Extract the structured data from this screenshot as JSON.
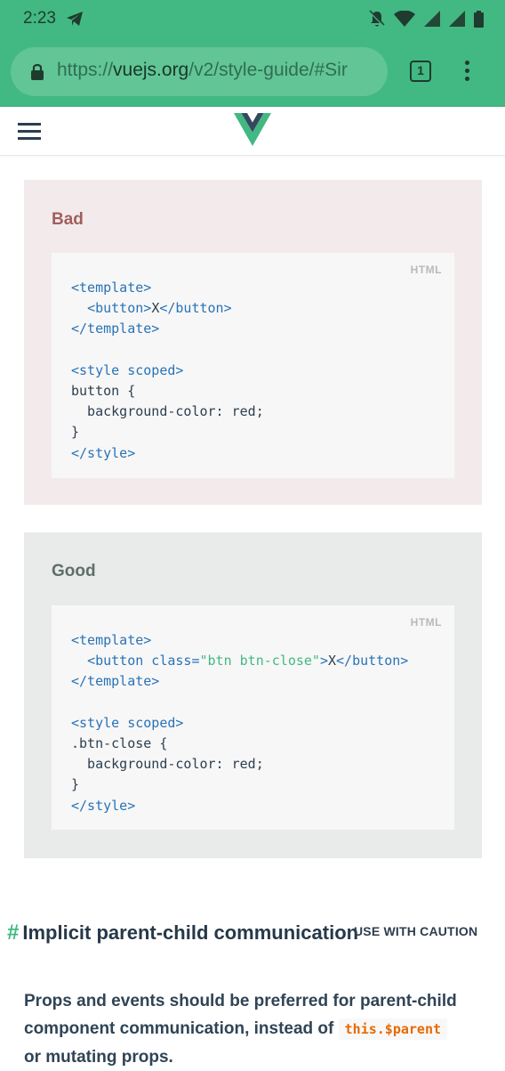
{
  "status_bar": {
    "time": "2:23",
    "icons": [
      "telegram-icon",
      "notifications-off-icon",
      "wifi-icon",
      "signal-icon",
      "signal-icon",
      "battery-icon"
    ]
  },
  "browser": {
    "url_prefix": "https://",
    "url_domain": "vuejs.org",
    "url_path": "/v2/style-guide/#Sir",
    "tab_count": "1"
  },
  "site": {
    "logo": "vue-logo"
  },
  "bad_example": {
    "heading": "Bad",
    "lang": "HTML",
    "code": {
      "l1": "<template>",
      "l2_open": "<button>",
      "l2_text": "X",
      "l2_close": "</button>",
      "l3": "</template>",
      "l5": "<style scoped>",
      "l6": "button {",
      "l7": "  background-color: red;",
      "l8": "}",
      "l9": "</style>"
    }
  },
  "good_example": {
    "heading": "Good",
    "lang": "HTML",
    "code": {
      "l1": "<template>",
      "l2_open": "<button class=",
      "l2_str": "\"btn btn-close\"",
      "l2_gt": ">",
      "l2_text": "X",
      "l2_close": "</button>",
      "l3": "</template>",
      "l5": "<style scoped>",
      "l6": ".btn-close {",
      "l7": "  background-color: red;",
      "l8": "}",
      "l9": "</style>"
    }
  },
  "section": {
    "hash": "#",
    "title": "Implicit parent-child communication",
    "badge": "USE WITH CAUTION",
    "para_1": "Props and events should be preferred for parent-child component communication, instead of ",
    "para_code": "this.$parent",
    "para_2": " or mutating props."
  },
  "colors": {
    "accent": "#42b883",
    "bad_bg": "#f3ebeb",
    "good_bg": "#e9ebeb"
  }
}
